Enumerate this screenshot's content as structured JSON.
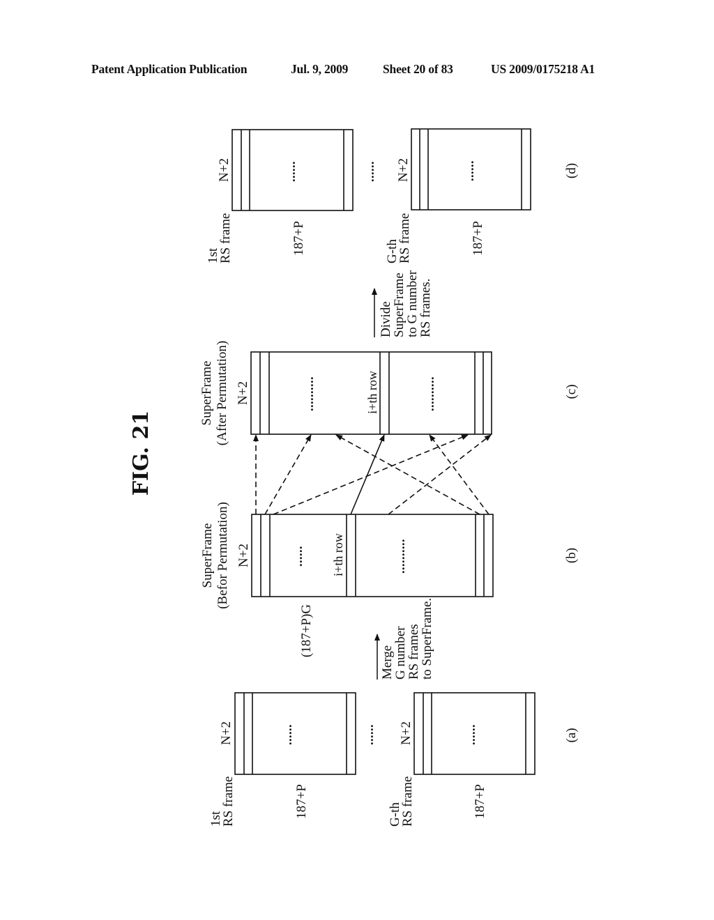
{
  "header": {
    "publication": "Patent Application Publication",
    "date": "Jul. 9, 2009",
    "sheet": "Sheet 20 of 83",
    "patent_number": "US 2009/0175218 A1"
  },
  "figure": {
    "title": "FIG. 21",
    "panels": {
      "a": {
        "caption": "(a)",
        "frames": [
          {
            "name_line1": "1st",
            "name_line2": "RS frame",
            "rows_label": "N+2",
            "cols_label": "187+P",
            "ellipsis": "......"
          },
          {
            "name_line1": "G-th",
            "name_line2": "RS frame",
            "rows_label": "N+2",
            "cols_label": "187+P",
            "ellipsis": "......"
          }
        ],
        "between_ellipsis": "......"
      },
      "merge_step": {
        "line1": "Merge",
        "line2": "G number",
        "line3": "RS frames",
        "line4": "to SuperFrame."
      },
      "b": {
        "caption": "(b)",
        "title_line1": "SuperFrame",
        "title_line2": "(Befor Permutation)",
        "rows_label": "N+2",
        "cols_label": "(187+P)G",
        "row_marker": "i+th row",
        "ellipsis_left": "......",
        "ellipsis_right": ".........."
      },
      "c": {
        "caption": "(c)",
        "title_line1": "SuperFrame",
        "title_line2": "(After Permutation)",
        "rows_label": "N+2",
        "row_marker": "i+th row",
        "ellipsis_left": "..........",
        "ellipsis_right": ".........."
      },
      "divide_step": {
        "line1": "Divide",
        "line2": "SuperFrame",
        "line3": "to G number",
        "line4": "RS frames."
      },
      "d": {
        "caption": "(d)",
        "frames": [
          {
            "name_line1": "1st",
            "name_line2": "RS frame",
            "rows_label": "N+2",
            "cols_label": "187+P",
            "ellipsis": "......"
          },
          {
            "name_line1": "G-th",
            "name_line2": "RS frame",
            "rows_label": "N+2",
            "cols_label": "187+P",
            "ellipsis": "......"
          }
        ],
        "between_ellipsis": "......"
      }
    }
  }
}
